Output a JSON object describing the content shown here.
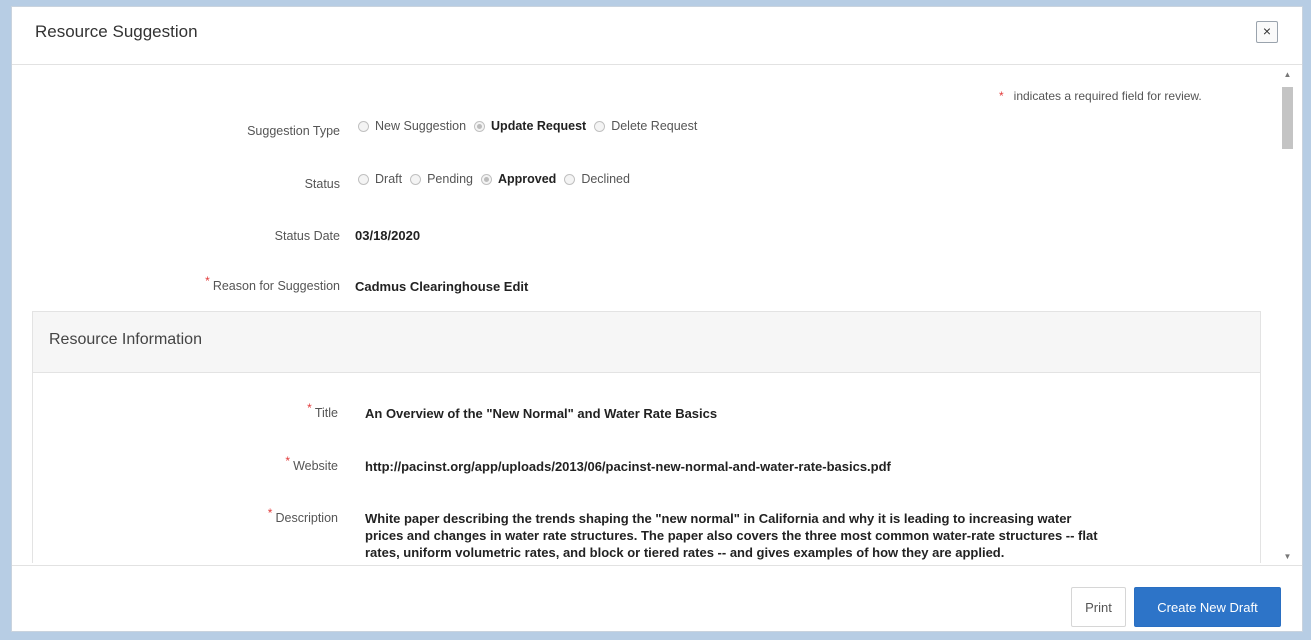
{
  "dialog": {
    "title": "Resource Suggestion",
    "close_label": "×"
  },
  "required_note": {
    "star": "*",
    "text": "indicates a required field for review."
  },
  "fields": {
    "suggestion_type": {
      "label": "Suggestion Type",
      "options": [
        {
          "label": "New Suggestion",
          "selected": false
        },
        {
          "label": "Update Request",
          "selected": true
        },
        {
          "label": "Delete Request",
          "selected": false
        }
      ]
    },
    "status": {
      "label": "Status",
      "options": [
        {
          "label": "Draft",
          "selected": false
        },
        {
          "label": "Pending",
          "selected": false
        },
        {
          "label": "Approved",
          "selected": true
        },
        {
          "label": "Declined",
          "selected": false
        }
      ]
    },
    "status_date": {
      "label": "Status Date",
      "value": "03/18/2020"
    },
    "reason": {
      "star": "*",
      "label": "Reason for Suggestion",
      "value": "Cadmus Clearinghouse Edit"
    }
  },
  "resource_info": {
    "heading": "Resource Information",
    "title": {
      "star": "*",
      "label": "Title",
      "value": "An Overview of the \"New Normal\" and Water Rate Basics"
    },
    "website": {
      "star": "*",
      "label": "Website",
      "value": "http://pacinst.org/app/uploads/2013/06/pacinst-new-normal-and-water-rate-basics.pdf"
    },
    "description": {
      "star": "*",
      "label": "Description",
      "lines": [
        "White paper describing the trends shaping the \"new normal\" in California and why it is leading to increasing water",
        "prices and changes in water rate structures. The paper also covers the three most common water-rate structures -- flat",
        "rates, uniform volumetric rates, and block or tiered rates -- and gives examples of how they are applied."
      ]
    }
  },
  "scrollbar": {
    "up_icon": "▲",
    "down_icon": "▼"
  },
  "footer": {
    "print_label": "Print",
    "create_label": "Create New Draft"
  },
  "colors": {
    "primary_button": "#2d74c8",
    "required_star": "#e23b3b",
    "backdrop": "#b7cde4"
  }
}
